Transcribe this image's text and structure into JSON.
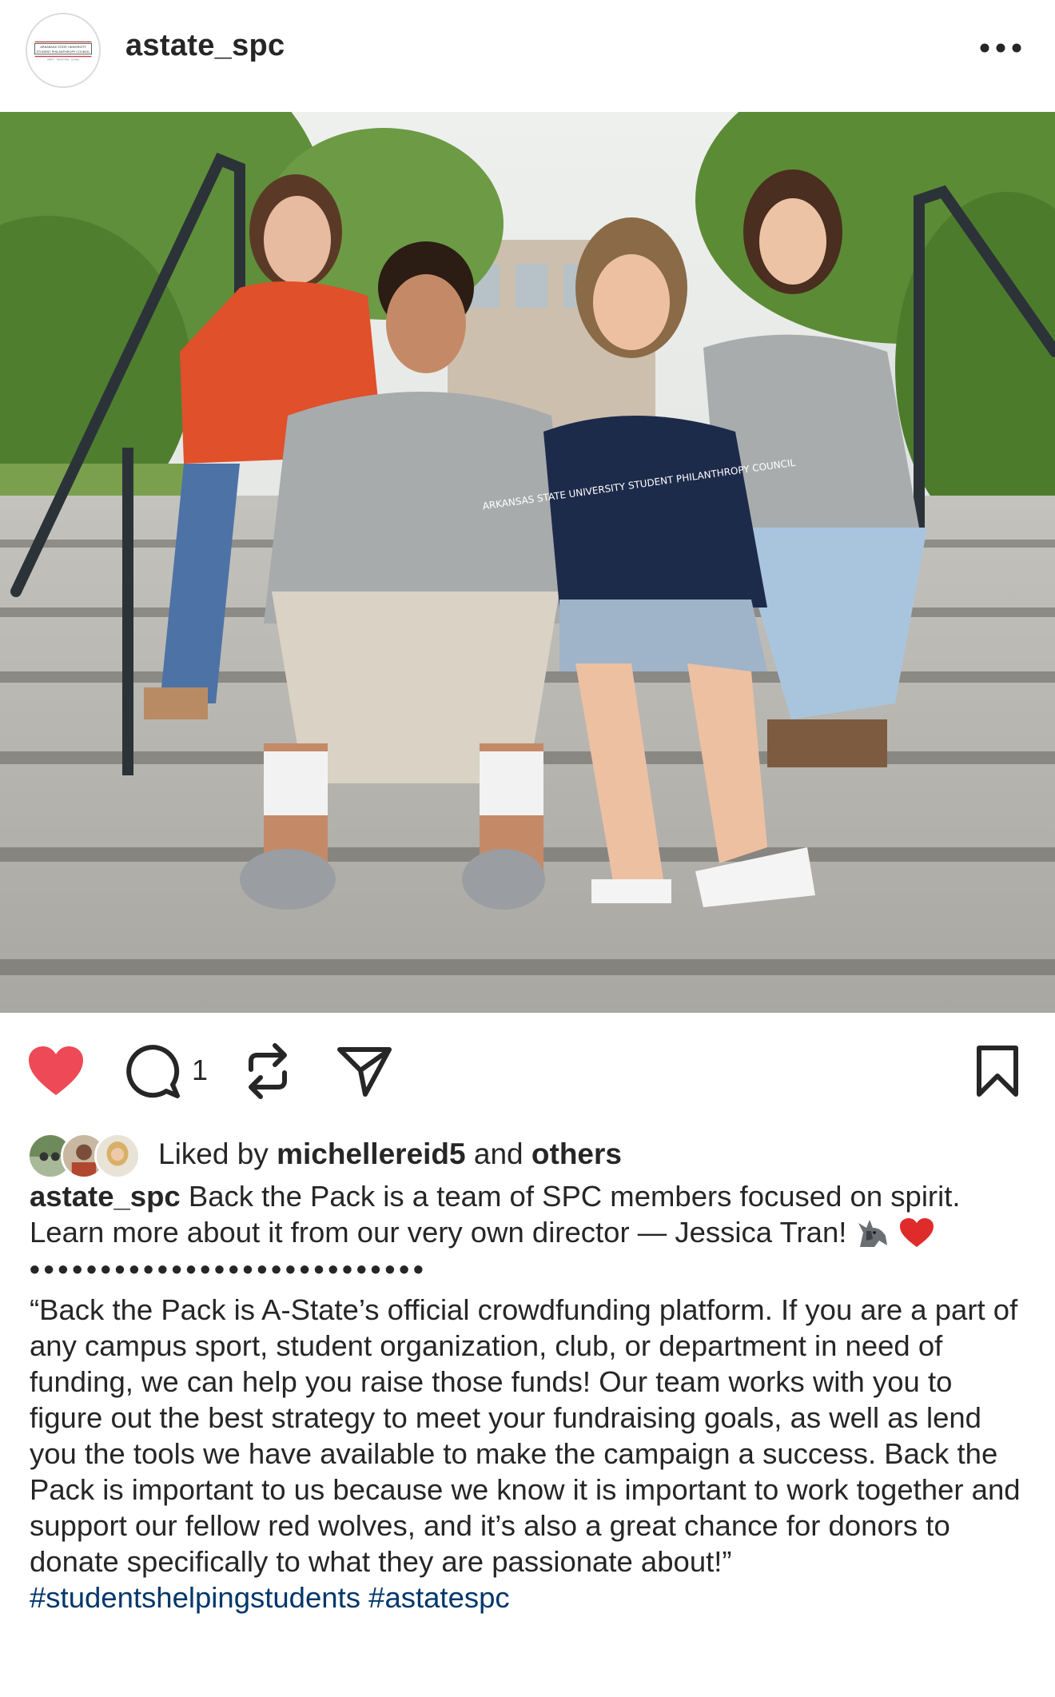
{
  "post": {
    "username": "astate_spc",
    "more_icon": "ellipsis-horizontal-icon",
    "avatar_label": "Arkansas State University Student Philanthropy Council"
  },
  "photo": {
    "alt": "",
    "shirt_text": "ARKANSAS STATE UNIVERSITY STUDENT PHILANTHROPY COUNCIL"
  },
  "actions": {
    "liked": true,
    "like_color": "#ed4956",
    "comment_count": "1",
    "icons": [
      "heart-icon",
      "comment-icon",
      "repost-icon",
      "share-icon",
      "bookmark-icon"
    ]
  },
  "likes": {
    "prefix": "Liked by ",
    "user": "michellereid5",
    "middle": " and ",
    "suffix": "others"
  },
  "caption": {
    "username": "astate_spc",
    "text": " Back the Pack is a team of SPC members focused on spirit. Learn more about it from our very own director — Jessica Tran! ",
    "dots": "••••••••••••••••••••••••••••",
    "quote": "“Back the Pack is A-State’s official crowdfunding platform. If you are a part of any campus sport, student organization, club, or department in need of funding, we can help you raise those funds! Our team works with you to figure out the best strategy to meet your fundraising goals, as well as lend you the tools we have available to make the campaign a success. Back the Pack is important to us because we know it is important to work together and support our fellow red wolves, and it’s also a great chance for donors to donate specifically to what they are passionate about!”",
    "hashtags": [
      "#studentshelpingstudents",
      "#astatespc"
    ],
    "hashtag_color": "#00376b"
  }
}
